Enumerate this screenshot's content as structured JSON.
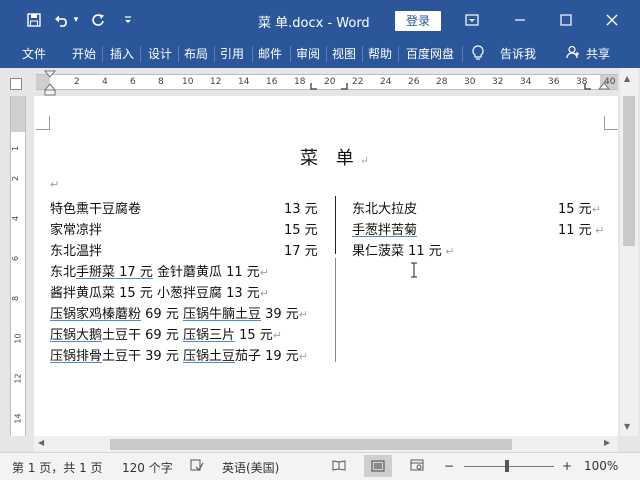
{
  "title_bar": {
    "doc_title": "菜 单.docx  -  Word",
    "login_label": "登录",
    "icons": [
      "save-icon",
      "undo-icon",
      "undo-dropdown-icon",
      "redo-icon",
      "customize-qat-icon",
      "ribbon-display-icon",
      "minimize-icon",
      "maximize-icon",
      "close-icon"
    ],
    "colors": {
      "bar": "#2b579a"
    }
  },
  "menu": {
    "items": [
      "文件",
      "开始",
      "插入",
      "设计",
      "布局",
      "引用",
      "邮件",
      "审阅",
      "视图",
      "帮助",
      "百度网盘"
    ],
    "tell_me": "告诉我",
    "share": "共享"
  },
  "ruler": {
    "h_numbers": [
      "2",
      "4",
      "6",
      "8",
      "10",
      "12",
      "14",
      "16",
      "18",
      "20",
      "22",
      "24",
      "26",
      "28",
      "30",
      "32",
      "34",
      "36",
      "38",
      "40"
    ],
    "v_numbers": [
      "1",
      "2",
      "4",
      "6",
      "8",
      "10",
      "12",
      "14"
    ]
  },
  "document": {
    "title": "菜  单",
    "left_column": [
      {
        "name": "特色熏干豆腐卷",
        "price": "13 元"
      },
      {
        "name": "家常凉拌",
        "price": "15 元"
      },
      {
        "name": "东北温拌",
        "price": "17 元"
      }
    ],
    "left_lines": [
      {
        "pre": "东北",
        "ul": "手掰菜 17 元",
        "post": " 金针蘑黄瓜 11 元"
      },
      {
        "pre": "酱拌黄瓜菜 15 元  小葱拌豆腐 13 元",
        "ul": "",
        "post": ""
      },
      {
        "pre": "",
        "ul": "压锅家鸡榛蘑粉",
        "post": " 69 元  ",
        "ul2": "压锅牛腩土豆",
        "post2": " 39 元"
      },
      {
        "pre": "",
        "ul": "压锅大鹅",
        "post": "土豆干 69 元  ",
        "ul2": "压锅三片",
        "post2": " 15 元"
      },
      {
        "pre": "",
        "ul": "压锅排骨",
        "post": "土豆干 39 元  ",
        "ul2": "压锅土豆",
        "post2": "茄子 19 元"
      }
    ],
    "right_column": [
      {
        "name": "东北大拉皮",
        "price": "15 元"
      },
      {
        "name": "手葱拌苦菊",
        "price": "11 元"
      },
      {
        "name": "果仁菠菜 11 元",
        "price": ""
      }
    ]
  },
  "status": {
    "page": "第 1 页，共 1 页",
    "words": "120 个字",
    "language": "英语(美国)",
    "zoom": "100%",
    "zoom_minus": "−",
    "zoom_plus": "+"
  }
}
